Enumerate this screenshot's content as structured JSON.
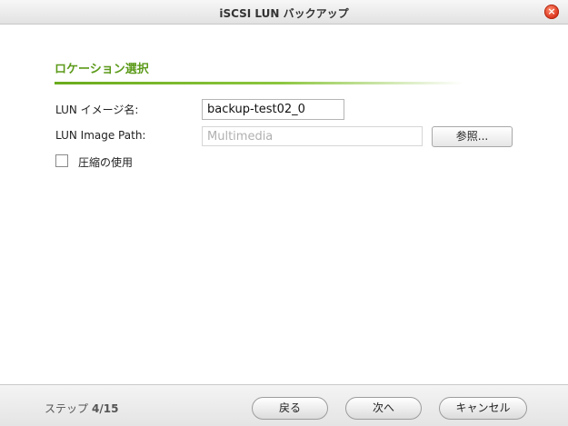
{
  "window": {
    "title": "iSCSI LUN バックアップ"
  },
  "section": {
    "title": "ロケーション選択"
  },
  "form": {
    "lun_image_name_label": "LUN イメージ名:",
    "lun_image_name_value": "backup-test02_0",
    "lun_image_path_label": "LUN Image Path:",
    "lun_image_path_value": "Multimedia",
    "browse_label": "参照...",
    "compress_label": "圧縮の使用",
    "compress_checked": false
  },
  "footer": {
    "step_label": "ステップ",
    "step_value": "4/15",
    "back_label": "戻る",
    "next_label": "次へ",
    "cancel_label": "キャンセル"
  },
  "icons": {
    "close": "close-icon"
  },
  "colors": {
    "accent": "#5c9a1a",
    "close": "#d9301a"
  }
}
